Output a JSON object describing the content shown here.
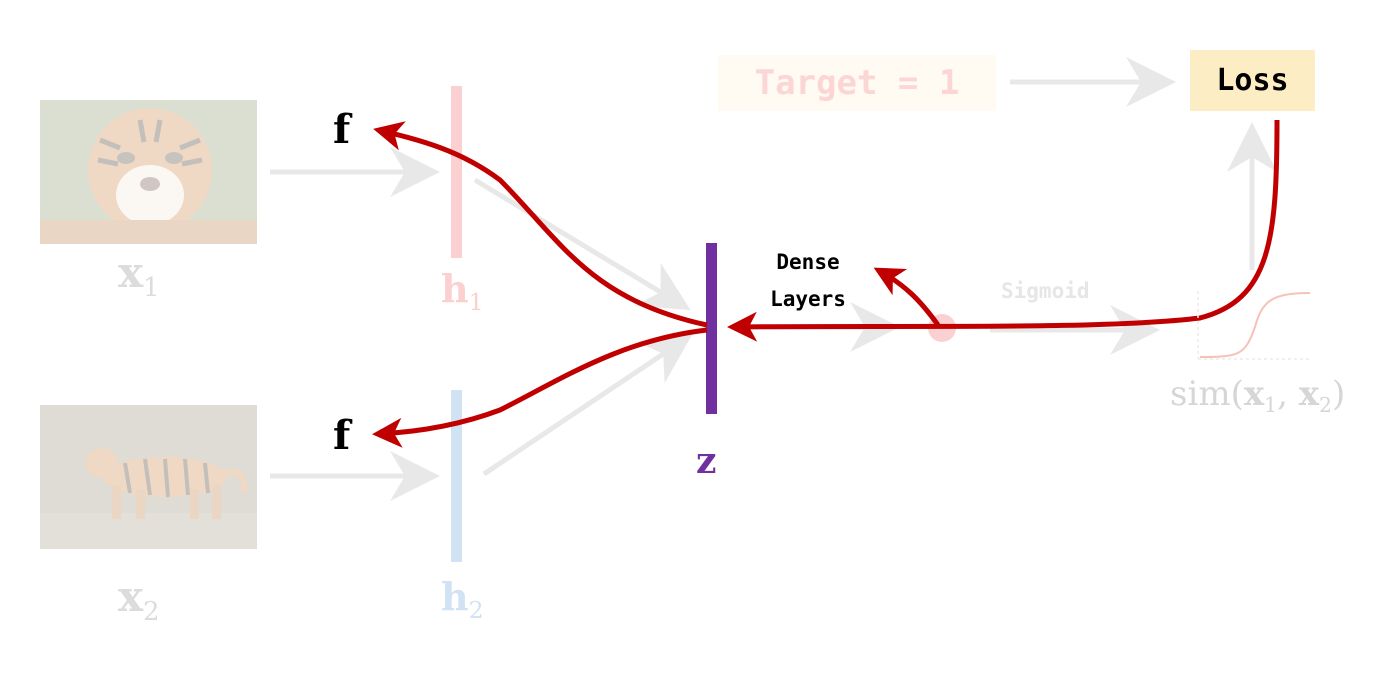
{
  "inputs": {
    "x1": {
      "base": "x",
      "sub": "1"
    },
    "x2": {
      "base": "x",
      "sub": "2"
    }
  },
  "hidden": {
    "h1": {
      "base": "h",
      "sub": "1"
    },
    "h2": {
      "base": "h",
      "sub": "2"
    }
  },
  "embedding": {
    "label": "z"
  },
  "features": {
    "f_top": "f",
    "f_bottom": "f"
  },
  "target": {
    "text": "Target = 1"
  },
  "loss": {
    "text": "Loss"
  },
  "dense": {
    "line1": "Dense",
    "line2": "Layers"
  },
  "sigmoid": {
    "text": "Sigmoid"
  },
  "similarity": {
    "fn": "sim(",
    "a": "x",
    "a_sub": "1",
    "sep": ", ",
    "b": "x",
    "b_sub": "2",
    "close": ")"
  },
  "colors": {
    "gradient_arrow": "#c00000",
    "z_bar": "#7030a0",
    "h1_bar": "#fbd0d0",
    "h2_bar": "#d2e2f5",
    "faded_arrow": "#e8e8e8",
    "loss_box": "#fdedc4",
    "target_box": "#fffaf2",
    "node_dot": "#fbd0d0"
  },
  "icons": {
    "tiger_photo_1": "tiger-face-photo",
    "tiger_photo_2": "tiger-standing-photo",
    "sigmoid_curve": "sigmoid-curve-icon"
  }
}
